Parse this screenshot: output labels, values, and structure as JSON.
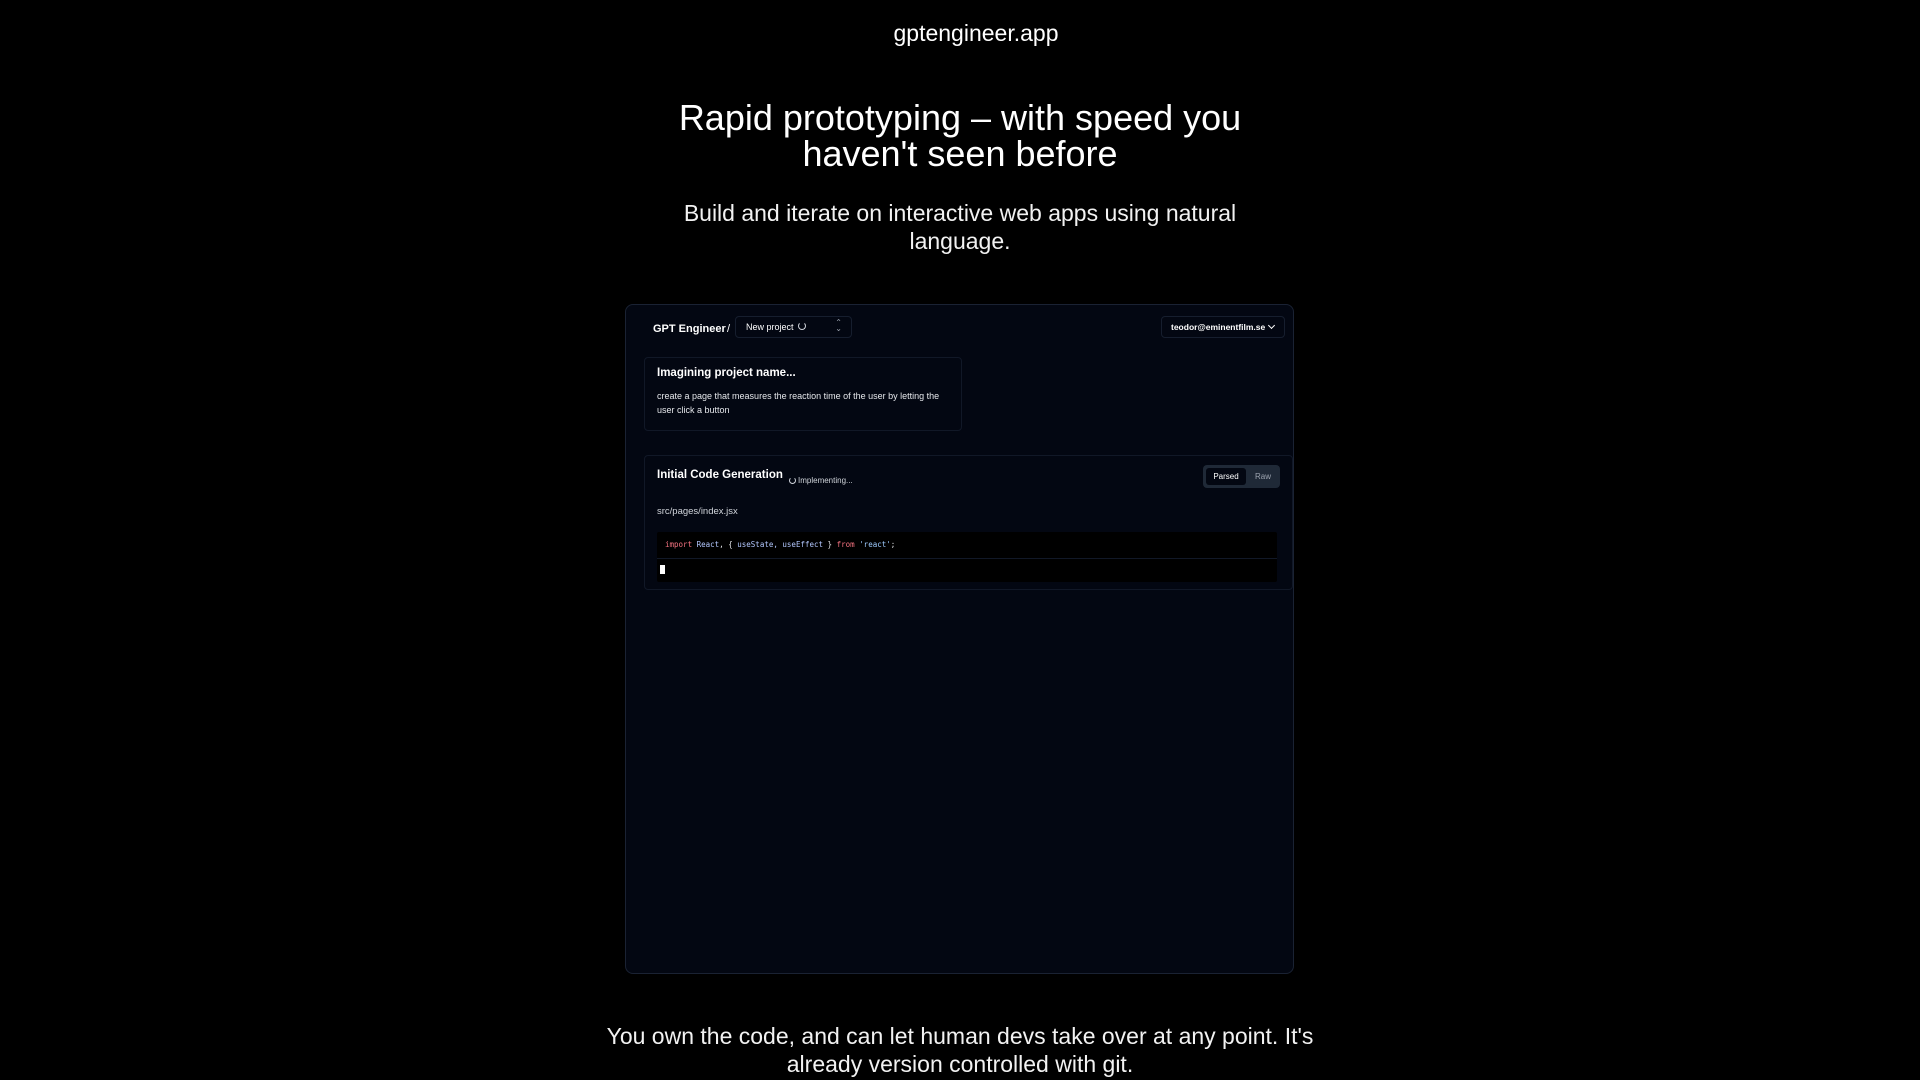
{
  "site": {
    "title": "gptengineer.app"
  },
  "hero": {
    "title": "Rapid prototyping – with speed you haven't seen before",
    "subtitle": "Build and iterate on interactive web apps using natural language."
  },
  "app": {
    "brand": "GPT Engineer",
    "brand_separator": "/",
    "project_select": {
      "label": "New project",
      "icon": "up-down-chevron-icon"
    },
    "user_menu": {
      "email": "teodor@eminentfilm.se",
      "icon": "chevron-down-icon"
    },
    "prompt_card": {
      "title": "Imagining project name...",
      "text": "create a page that measures the reaction time of the user by letting the user click a button"
    },
    "codegen": {
      "title": "Initial Code Generation",
      "status": "Implementing...",
      "toggle": {
        "parsed": "Parsed",
        "raw": "Raw",
        "selected": "Parsed"
      },
      "file_path": "src/pages/index.jsx",
      "code_tokens": {
        "import": "import",
        "react_id": "React",
        "brace_open": ", { ",
        "hooks": "useState, useEffect",
        "brace_close": " } ",
        "from": "from",
        "module": "'react'",
        "semi": ";"
      }
    }
  },
  "footer": {
    "text": "You own the code, and can let human devs take over at any point. It's already version controlled with git."
  },
  "colors": {
    "page_bg": "#000000",
    "app_bg": "#030712",
    "border": "#1a2233",
    "keyword": "#f97583",
    "string": "#9ecbff"
  }
}
